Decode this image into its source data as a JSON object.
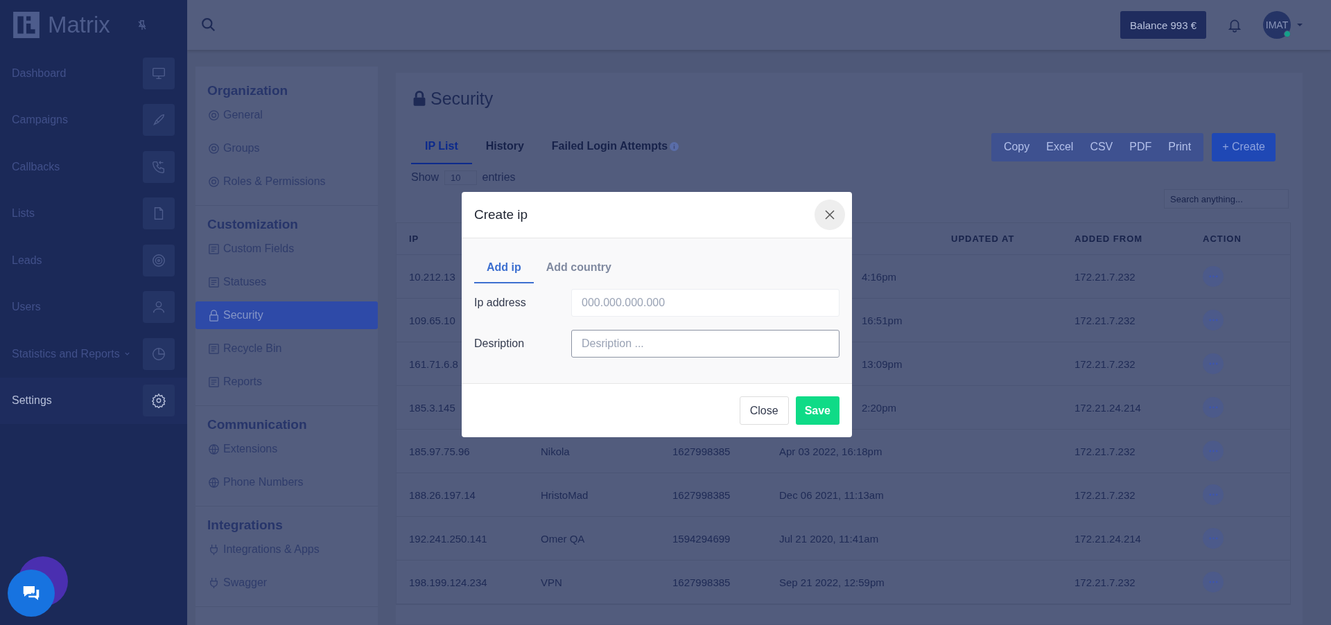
{
  "sidebar": {
    "logo": "Matrix",
    "items": [
      {
        "label": "Dashboard",
        "selected": false,
        "expandable": false
      },
      {
        "label": "Campaigns",
        "selected": false,
        "expandable": false
      },
      {
        "label": "Callbacks",
        "selected": false,
        "expandable": false
      },
      {
        "label": "Lists",
        "selected": false,
        "expandable": false
      },
      {
        "label": "Leads",
        "selected": false,
        "expandable": false
      },
      {
        "label": "Users",
        "selected": false,
        "expandable": false
      },
      {
        "label": "Statistics and Reports",
        "selected": false,
        "expandable": true
      },
      {
        "label": "Settings",
        "selected": true,
        "expandable": false
      }
    ]
  },
  "topbar": {
    "balance": "Balance 993 €",
    "avatar": "IMAT",
    "online": true
  },
  "settings_menu": [
    {
      "title": "Organization",
      "items": [
        {
          "label": "General",
          "selected": false
        },
        {
          "label": "Groups",
          "selected": false
        },
        {
          "label": "Roles & Permissions",
          "selected": false
        }
      ]
    },
    {
      "title": "Customization",
      "items": [
        {
          "label": "Custom Fields",
          "selected": false
        },
        {
          "label": "Statuses",
          "selected": false
        },
        {
          "label": "Security",
          "selected": true
        },
        {
          "label": "Recycle Bin",
          "selected": false
        },
        {
          "label": "Reports",
          "selected": false
        }
      ]
    },
    {
      "title": "Communication",
      "items": [
        {
          "label": "Extensions",
          "selected": false
        },
        {
          "label": "Phone Numbers",
          "selected": false
        }
      ]
    },
    {
      "title": "Integrations",
      "items": [
        {
          "label": "Integrations & Apps",
          "selected": false
        },
        {
          "label": "Swagger",
          "selected": false
        }
      ]
    }
  ],
  "page": {
    "title": "Security",
    "tabs": [
      {
        "label": "IP List",
        "selected": true,
        "info": false
      },
      {
        "label": "History",
        "selected": false,
        "info": false
      },
      {
        "label": "Failed Login Attempts",
        "selected": false,
        "info": true
      }
    ],
    "export_buttons": [
      "Copy",
      "Excel",
      "CSV",
      "PDF",
      "Print"
    ],
    "create_button": "+ Create",
    "show": {
      "label": "Show",
      "value": "10",
      "suffix": "entries"
    },
    "search": {
      "placeholder": "Search anything..."
    },
    "table": {
      "columns": [
        "IP",
        "UPDATED AT",
        "ADDED FROM",
        "ACTION"
      ],
      "rows": [
        {
          "kind": "partial",
          "ip": "10.212.13",
          "date": "4:16pm",
          "added_from": "172.21.7.232"
        },
        {
          "kind": "partial",
          "ip": "109.65.10",
          "date": "16:51pm",
          "added_from": "172.21.7.232"
        },
        {
          "kind": "partial",
          "ip": "161.71.6.8",
          "date": "13:09pm",
          "added_from": "172.21.7.232"
        },
        {
          "kind": "partial",
          "ip": "185.3.145",
          "date": "2:20pm",
          "added_from": "172.21.24.214"
        },
        {
          "kind": "full",
          "ip": "185.97.75.96",
          "name": "Nikola",
          "number": "1627998385",
          "date": "Apr 03 2022, 16:18pm",
          "added_from": "172.21.7.232"
        },
        {
          "kind": "full",
          "ip": "188.26.197.14",
          "name": "HristoMad",
          "number": "1627998385",
          "date": "Dec 06 2021, 11:13am",
          "added_from": "172.21.7.232"
        },
        {
          "kind": "full",
          "ip": "192.241.250.141",
          "name": "Omer QA",
          "number": "1594294699",
          "date": "Jul 21 2020, 11:41am",
          "added_from": "172.21.24.214"
        },
        {
          "kind": "full",
          "ip": "198.199.124.234",
          "name": "VPN",
          "number": "1627998385",
          "date": "Sep 21 2022, 12:59pm",
          "added_from": "172.21.7.232"
        }
      ]
    }
  },
  "modal": {
    "title": "Create ip",
    "tabs": [
      {
        "label": "Add ip",
        "selected": true
      },
      {
        "label": "Add country",
        "selected": false
      }
    ],
    "fields": [
      {
        "label": "Ip address",
        "placeholder": "000.000.000.000",
        "focused": false
      },
      {
        "label": "Desription",
        "placeholder": "Desription ...",
        "focused": true
      }
    ],
    "close_button": "Close",
    "save_button": "Save"
  }
}
